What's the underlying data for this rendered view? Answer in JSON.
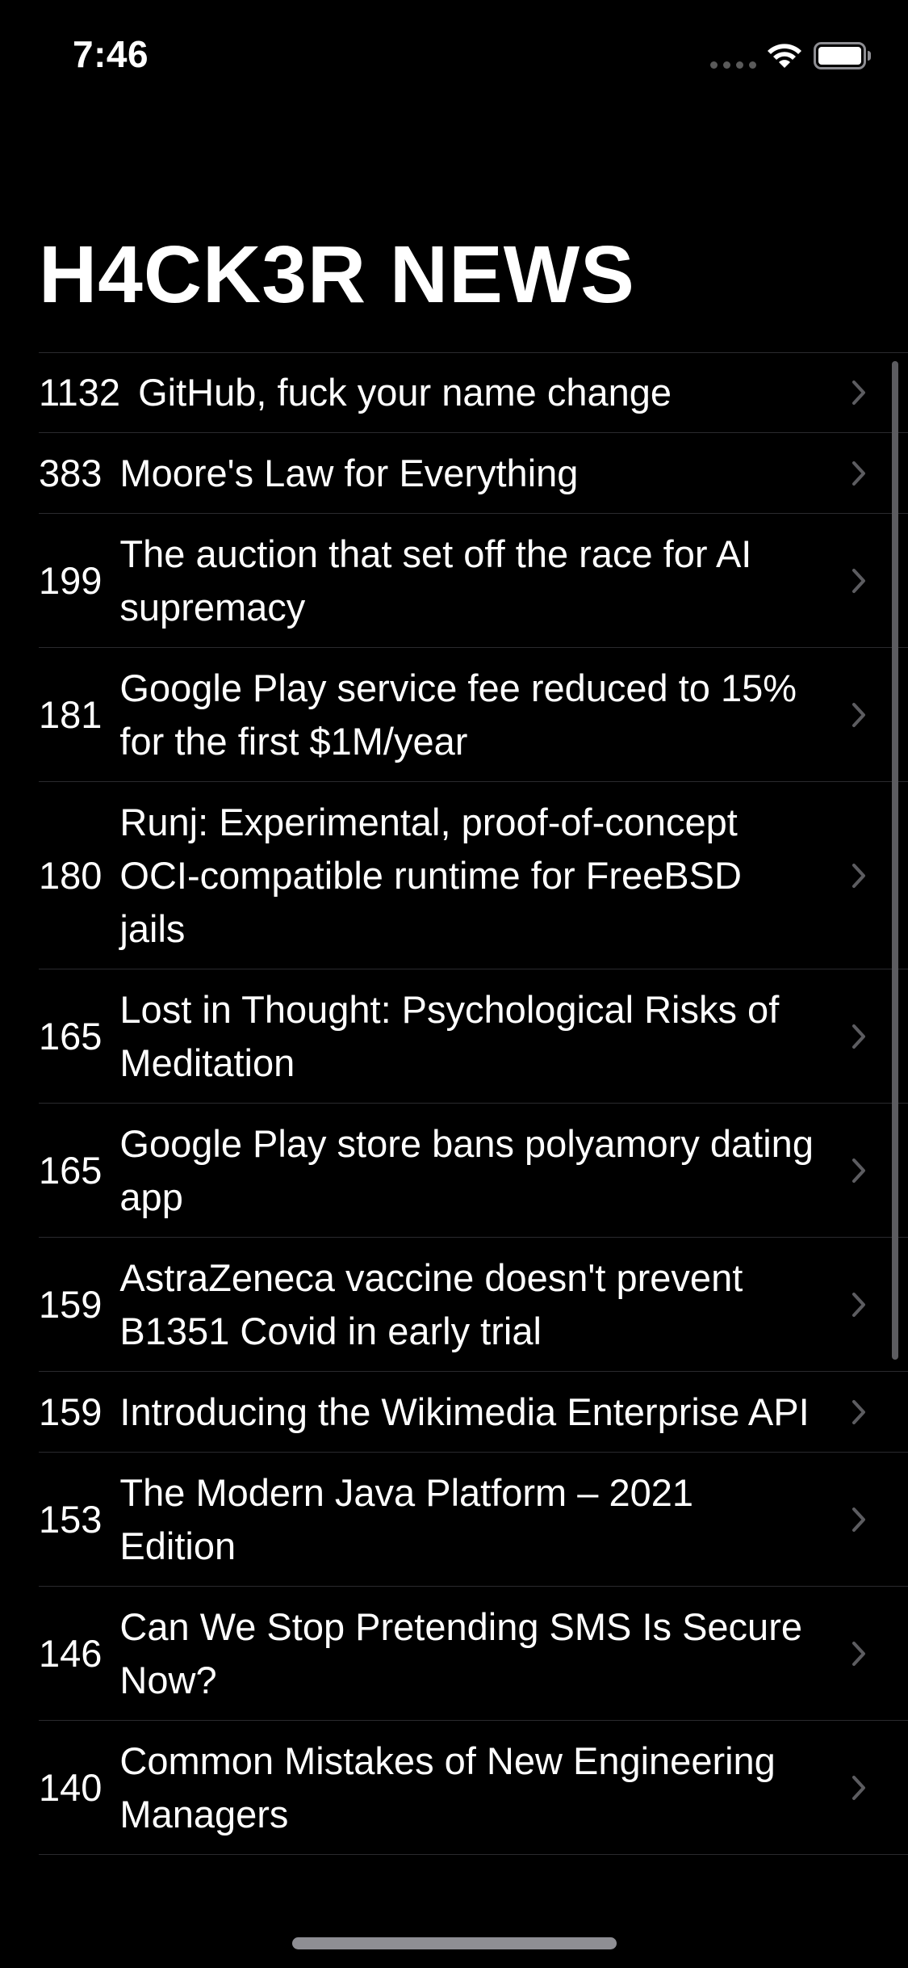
{
  "status_bar": {
    "time": "7:46"
  },
  "header": {
    "title": "H4CK3R NEWS"
  },
  "stories": [
    {
      "points": "1132",
      "title": "GitHub, fuck your name change"
    },
    {
      "points": "383",
      "title": "Moore's Law for Everything"
    },
    {
      "points": "199",
      "title": "The auction that set off the race for AI supremacy"
    },
    {
      "points": "181",
      "title": "Google Play service fee reduced to 15% for the first $1M/year"
    },
    {
      "points": "180",
      "title": "Runj: Experimental, proof-of-concept OCI-compatible runtime for FreeBSD jails"
    },
    {
      "points": "165",
      "title": "Lost in Thought: Psychological Risks of Meditation"
    },
    {
      "points": "165",
      "title": "Google Play store bans polyamory dating app"
    },
    {
      "points": "159",
      "title": "AstraZeneca vaccine doesn't prevent B1351 Covid in early trial"
    },
    {
      "points": "159",
      "title": "Introducing the Wikimedia Enterprise API"
    },
    {
      "points": "153",
      "title": "The Modern Java Platform – 2021 Edition"
    },
    {
      "points": "146",
      "title": "Can We Stop Pretending SMS Is Secure Now?"
    },
    {
      "points": "140",
      "title": "Common Mistakes of New Engineering Managers"
    }
  ],
  "icons": {
    "chevron": "chevron-right-icon",
    "wifi": "wifi-icon",
    "battery": "battery-icon",
    "signal": "cellular-signal-icon"
  },
  "colors": {
    "background": "#000000",
    "text": "#ffffff",
    "separator": "#2a2a2e",
    "chevron": "#5c5c60",
    "signal_inactive": "#5a5a5a"
  }
}
